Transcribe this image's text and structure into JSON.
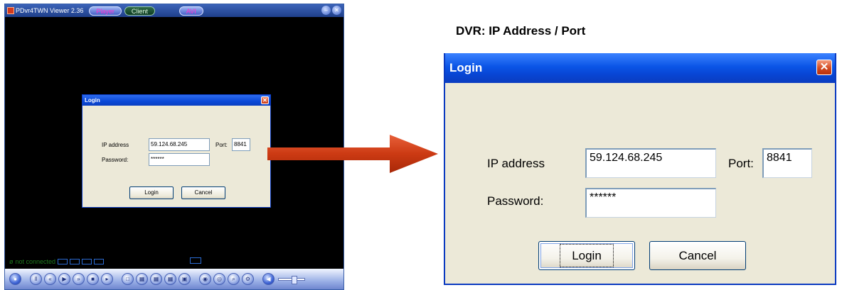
{
  "viewer": {
    "title": "PDvr4TWN Viewer 2.36",
    "tabs": [
      {
        "label": "Player"
      },
      {
        "label": "Client"
      },
      {
        "label": "AVI"
      }
    ],
    "status": "not connected",
    "small_dialog": {
      "title": "Login",
      "ip_label": "IP address",
      "ip_value": "59.124.68.245",
      "port_label": "Port:",
      "port_value": "8841",
      "password_label": "Password:",
      "password_value": "******",
      "login_label": "Login",
      "cancel_label": "Cancel"
    }
  },
  "heading": "DVR: IP Address / Port",
  "dialog": {
    "title": "Login",
    "ip_label": "IP address",
    "ip_value": "59.124.68.245",
    "port_label": "Port:",
    "port_value": "8841",
    "password_label": "Password:",
    "password_value": "******",
    "login_label": "Login",
    "cancel_label": "Cancel"
  },
  "colors": {
    "titlebar_blue": "#0a48d6",
    "dialog_face": "#ece9d8",
    "arrow_red": "#cc3a13",
    "status_green": "#1e7a1e"
  }
}
